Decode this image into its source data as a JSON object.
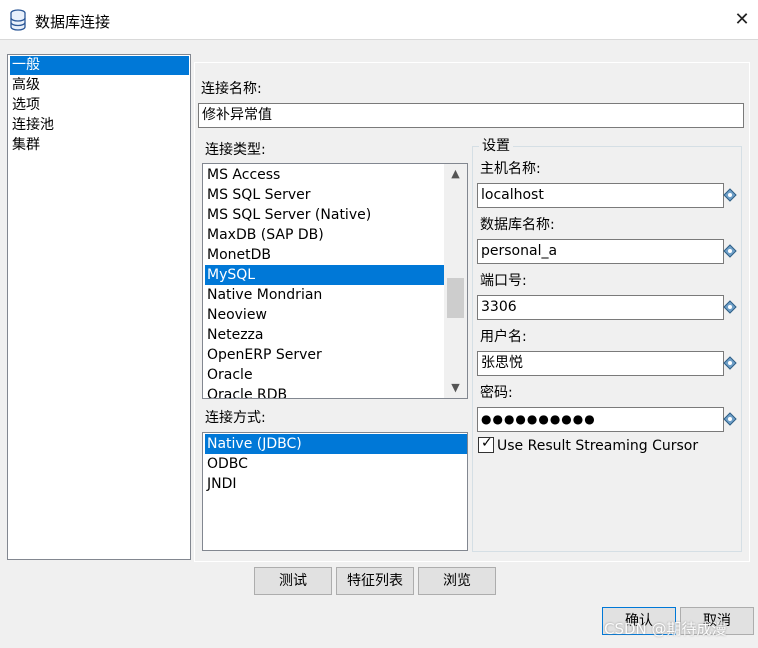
{
  "window": {
    "title": "数据库连接",
    "close_icon": "close-icon"
  },
  "sidebar": {
    "items": [
      {
        "label": "一般",
        "selected": true
      },
      {
        "label": "高级",
        "selected": false
      },
      {
        "label": "选项",
        "selected": false
      },
      {
        "label": "连接池",
        "selected": false
      },
      {
        "label": "集群",
        "selected": false
      }
    ]
  },
  "connection_name": {
    "label": "连接名称:",
    "value": "修补异常值"
  },
  "connection_type": {
    "label": "连接类型:",
    "items": [
      {
        "label": "MS Access",
        "selected": false
      },
      {
        "label": "MS SQL Server",
        "selected": false
      },
      {
        "label": "MS SQL Server (Native)",
        "selected": false
      },
      {
        "label": "MaxDB (SAP DB)",
        "selected": false
      },
      {
        "label": "MonetDB",
        "selected": false
      },
      {
        "label": "MySQL",
        "selected": true
      },
      {
        "label": "Native Mondrian",
        "selected": false
      },
      {
        "label": "Neoview",
        "selected": false
      },
      {
        "label": "Netezza",
        "selected": false
      },
      {
        "label": "OpenERP Server",
        "selected": false
      },
      {
        "label": "Oracle",
        "selected": false
      },
      {
        "label": "Oracle RDB",
        "selected": false
      }
    ]
  },
  "connection_method": {
    "label": "连接方式:",
    "items": [
      {
        "label": "Native (JDBC)",
        "selected": true
      },
      {
        "label": "ODBC",
        "selected": false
      },
      {
        "label": "JNDI",
        "selected": false
      }
    ]
  },
  "settings": {
    "title": "设置",
    "host_label": "主机名称:",
    "host_value": "localhost",
    "db_label": "数据库名称:",
    "db_value": "personal_a",
    "port_label": "端口号:",
    "port_value": "3306",
    "user_label": "用户名:",
    "user_value": "张思悦",
    "password_label": "密码:",
    "password_value": "●●●●●●●●●●",
    "streaming_label": "Use Result Streaming Cursor",
    "streaming_checked": true
  },
  "buttons": {
    "test": "测试",
    "features": "特征列表",
    "browse": "浏览",
    "ok": "确认",
    "cancel": "取消"
  },
  "watermark": "CSDN @期待成漫",
  "colors": {
    "selection": "#0078d7",
    "dialog_bg": "#f0f0f0"
  }
}
